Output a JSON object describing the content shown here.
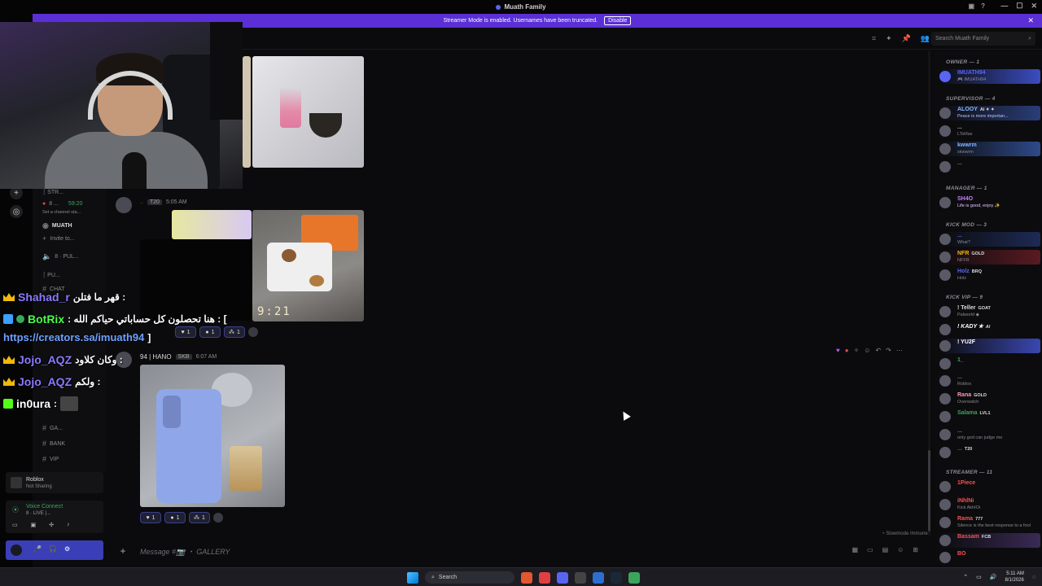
{
  "window": {
    "title": "Muath Family",
    "controls": [
      "—",
      "☐",
      "✕"
    ]
  },
  "streamer_banner": {
    "message": "Streamer Mode is enabled. Usernames have been truncated.",
    "button": "Disable"
  },
  "header": {
    "search_placeholder": "Search Muath Family"
  },
  "sidebar": {
    "items": [
      {
        "label": "┆ STR...",
        "kind": "category"
      },
      {
        "label": "8 ...",
        "time": "59:20",
        "status": "Set a channel sta..."
      },
      {
        "label": "MUATH",
        "kind": "user"
      },
      {
        "label": "Invite to...",
        "kind": "action"
      },
      {
        "label": "8 · PUL...",
        "kind": "voice"
      },
      {
        "label": "┆ PU...",
        "kind": "category"
      },
      {
        "label": "CHAT",
        "kind": "text"
      },
      {
        "label": "GA...",
        "kind": "text"
      },
      {
        "label": "BANK",
        "kind": "text"
      },
      {
        "label": "VIP",
        "kind": "text"
      }
    ]
  },
  "messages": {
    "msg1": {
      "badge": "T20",
      "time": "5:05 AM",
      "photo_stamp": "9:21"
    },
    "msg1_reactions": [
      {
        "emoji": "♥",
        "count": "1"
      },
      {
        "emoji": "●",
        "count": "1"
      },
      {
        "emoji": "⁂",
        "count": "1"
      }
    ],
    "msg2": {
      "name": "94 | HANO",
      "badge": "SKB",
      "time": "6:07 AM"
    },
    "msg2_reactions": [
      {
        "emoji": "♥",
        "count": "1"
      },
      {
        "emoji": "●",
        "count": "1"
      },
      {
        "emoji": "⁂",
        "count": "1"
      }
    ]
  },
  "slowmode_label": "Slowmode Immune",
  "composer": {
    "placeholder": "Message #📷 ・ GALLERY"
  },
  "activity": {
    "title": "Roblox",
    "subtitle": "Not Sharing"
  },
  "voice": {
    "title": "Voice Connect",
    "subtitle": "8 · LIVE |..."
  },
  "overlay_chat": [
    {
      "name": "Shahad_r",
      "name_color": "#8a7bff",
      "text": "قهر ما فتلن :"
    },
    {
      "name": "BotRix",
      "name_color": "#4cff4c",
      "text": ": هنا تحصلون كل حساباتي حياكم الله : ["
    },
    {
      "link": "https://creators.sa/imuath94",
      "text": "]"
    },
    {
      "name": "Jojo_AQZ",
      "name_color": "#8a7bff",
      "text": "وكان كلاود :"
    },
    {
      "name": "Jojo_AQZ",
      "name_color": "#8a7bff",
      "text": "ولكم :"
    },
    {
      "name": "in0ura",
      "name_color": "#ffffff",
      "text": ":"
    }
  ],
  "members": {
    "groups": [
      {
        "label": "OWNER — 1"
      },
      {
        "label": "SUPERVISOR — 4"
      },
      {
        "label": "MANAGER — 1"
      },
      {
        "label": "KICK MOD — 3"
      },
      {
        "label": "KICK VIP — 9"
      },
      {
        "label": "STREAMER — 11"
      }
    ],
    "rows": [
      {
        "name": "IMUATH94",
        "sub": "🎮 IMUATH94",
        "color": "#5865f2"
      },
      {
        "name": "ALOOY",
        "tag": "AI ✦ ✦",
        "sub": "Peace is more importan...",
        "color": "#8ab4ff"
      },
      {
        "name": "...",
        "sub": "LTsMax",
        "color": "#aaaaaa"
      },
      {
        "name": "kwwrm",
        "sub": "xkwwrm",
        "color": "#7db7ff"
      },
      {
        "name": "...",
        "sub": "",
        "color": "#777777"
      },
      {
        "name": "SH4O",
        "sub": "Life is good, enjoy ✨",
        "color": "#c77dff"
      },
      {
        "name": "...",
        "sub": "What?",
        "color": "#5865f2"
      },
      {
        "name": "NFR",
        "tag": "GOLD",
        "sub": "NFFR",
        "color": "#f0b90b"
      },
      {
        "name": "Holz",
        "tag": "BRQ",
        "sub": "Holz",
        "color": "#5865f2"
      },
      {
        "name": "! Teller",
        "tag": "GOAT",
        "sub": "Palworld ◆",
        "color": "#dddddd"
      },
      {
        "name": "! KADY ✯",
        "tag": "AI",
        "sub": "",
        "color": "#ffffff"
      },
      {
        "name": "! YU2F",
        "sub": "",
        "color": "#ffffff"
      },
      {
        "name": "1_",
        "sub": "",
        "color": "#3ba55d"
      },
      {
        "name": "...",
        "sub": "Roblox",
        "color": "#777777"
      },
      {
        "name": "Rana",
        "tag": "GOLD",
        "sub": "Overwatch",
        "color": "#ff9ab5"
      },
      {
        "name": "Salama",
        "tag": "LVL1",
        "sub": "",
        "color": "#3ba55d"
      },
      {
        "name": "...",
        "sub": "only god can judge me",
        "color": "#777777"
      },
      {
        "name": "...",
        "tag": "T20",
        "sub": "",
        "color": "#c0392b"
      },
      {
        "name": "1Piece",
        "sub": "",
        "color": "#ff4d4d"
      },
      {
        "name": "iNhlNi",
        "sub": "Kick AkhIOi",
        "color": "#ff4d4d"
      },
      {
        "name": "Rama",
        "tag": "777",
        "sub": "Silence is the best response to a fool",
        "color": "#ff4d4d"
      },
      {
        "name": "Bassam",
        "tag": "FCB",
        "sub": "",
        "color": "#ff4d4d"
      },
      {
        "name": "BO",
        "sub": "",
        "color": "#ff4d4d"
      }
    ]
  },
  "taskbar": {
    "search": "Search",
    "time": "5:11 AM",
    "date": "8/1/2026"
  }
}
